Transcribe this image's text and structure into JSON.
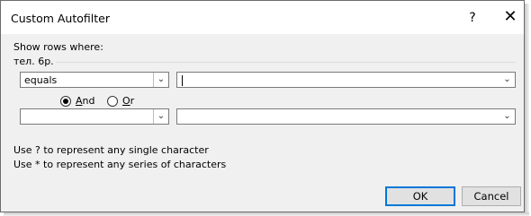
{
  "dialog": {
    "title": "Custom Autofilter",
    "help_label": "?",
    "close_label": "✕",
    "show_rows_label": "Show rows where:",
    "field_name": "тел. 6р."
  },
  "criteria1": {
    "operator": "equals",
    "value": ""
  },
  "logic": {
    "and_prefix": "",
    "and_mnemonic": "A",
    "and_rest": "nd",
    "or_mnemonic": "O",
    "or_rest": "r",
    "selected": "And"
  },
  "criteria2": {
    "operator": "",
    "value": ""
  },
  "hints": {
    "line1": "Use ? to represent any single character",
    "line2": "Use * to represent any series of characters"
  },
  "buttons": {
    "ok": "OK",
    "cancel": "Cancel"
  },
  "icons": {
    "dropdown": "chevron-down-icon",
    "close": "close-icon",
    "help": "help-icon"
  }
}
